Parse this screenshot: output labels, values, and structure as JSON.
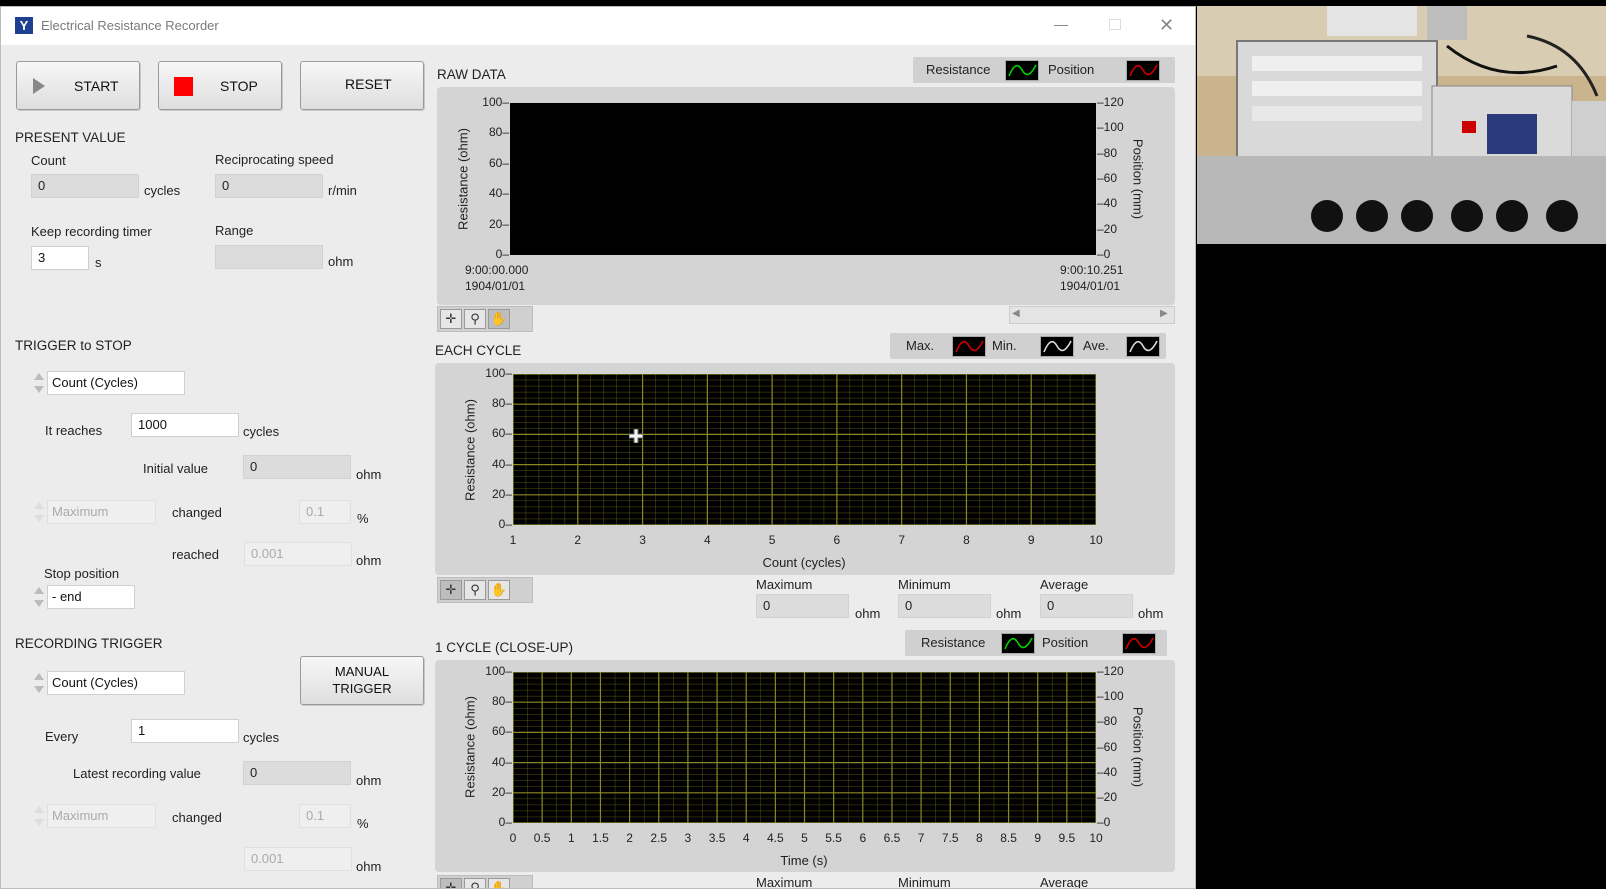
{
  "window": {
    "title": "Electrical Resistance Recorder",
    "app_icon": "Y"
  },
  "controls": {
    "start": "START",
    "stop": "STOP",
    "reset": "RESET",
    "manual_trigger": "MANUAL\nTRIGGER"
  },
  "present_value": {
    "heading": "PRESENT VALUE",
    "count_label": "Count",
    "count_value": "0",
    "count_unit": "cycles",
    "speed_label": "Reciprocating speed",
    "speed_value": "0",
    "speed_unit": "r/min",
    "timer_label": "Keep recording timer",
    "timer_value": "3",
    "timer_unit": "s",
    "range_label": "Range",
    "range_value": "",
    "range_unit": "ohm"
  },
  "trigger_stop": {
    "heading": "TRIGGER to STOP",
    "mode": "Count (Cycles)",
    "reaches_label": "It reaches",
    "reaches_value": "1000",
    "reaches_unit": "cycles",
    "initial_label": "Initial value",
    "initial_value": "0",
    "initial_unit": "ohm",
    "max_mode": "Maximum",
    "changed_label": "changed",
    "changed_value": "0.1",
    "changed_unit": "%",
    "reached_label": "reached",
    "reached_value": "0.001",
    "reached_unit": "ohm",
    "stop_position_label": "Stop position",
    "stop_position_value": "- end"
  },
  "recording_trigger": {
    "heading": "RECORDING TRIGGER",
    "mode": "Count (Cycles)",
    "every_label": "Every",
    "every_value": "1",
    "every_unit": "cycles",
    "latest_label": "Latest recording value",
    "latest_value": "0",
    "latest_unit": "ohm",
    "max_mode": "Maximum",
    "changed_label": "changed",
    "changed_value": "0.1",
    "changed_unit": "%",
    "threshold_value": "0.001",
    "threshold_unit": "ohm"
  },
  "raw_data": {
    "title": "RAW DATA",
    "legend": [
      "Resistance",
      "Position"
    ],
    "y_left_label": "Resistance (ohm)",
    "y_left_ticks": [
      "100",
      "80",
      "60",
      "40",
      "20",
      "0"
    ],
    "y_right_label": "Position (mm)",
    "y_right_ticks": [
      "120",
      "100",
      "80",
      "60",
      "40",
      "20",
      "0"
    ],
    "x_start_time": "9:00:00.000",
    "x_start_date": "1904/01/01",
    "x_end_time": "9:00:10.251",
    "x_end_date": "1904/01/01"
  },
  "each_cycle": {
    "title": "EACH CYCLE",
    "legend": [
      "Max.",
      "Min.",
      "Ave."
    ],
    "y_label": "Resistance (ohm)",
    "y_ticks": [
      "100",
      "80",
      "60",
      "40",
      "20",
      "0"
    ],
    "x_label": "Count (cycles)",
    "x_ticks": [
      "1",
      "2",
      "3",
      "4",
      "5",
      "6",
      "7",
      "8",
      "9",
      "10"
    ],
    "stats": {
      "max_label": "Maximum",
      "max_value": "0",
      "min_label": "Minimum",
      "min_value": "0",
      "avg_label": "Average",
      "avg_value": "0",
      "unit": "ohm"
    }
  },
  "one_cycle": {
    "title": "1 CYCLE (CLOSE-UP)",
    "legend": [
      "Resistance",
      "Position"
    ],
    "y_left_label": "Resistance (ohm)",
    "y_left_ticks": [
      "100",
      "80",
      "60",
      "40",
      "20",
      "0"
    ],
    "y_right_label": "Position (mm)",
    "y_right_ticks": [
      "120",
      "100",
      "80",
      "60",
      "40",
      "20",
      "0"
    ],
    "x_label": "Time (s)",
    "x_ticks": [
      "0",
      "0.5",
      "1",
      "1.5",
      "2",
      "2.5",
      "3",
      "3.5",
      "4",
      "4.5",
      "5",
      "5.5",
      "6",
      "6.5",
      "7",
      "7.5",
      "8",
      "8.5",
      "9",
      "9.5",
      "10"
    ],
    "stats": {
      "max_label": "Maximum",
      "min_label": "Minimum",
      "avg_label": "Average"
    }
  },
  "colors": {
    "grid": "#8a8a24",
    "plot_bg": "#000000",
    "panel_bg": "#ececec",
    "stop_red": "#ff0000",
    "trace_green": "#00d000",
    "trace_red": "#d00000"
  }
}
